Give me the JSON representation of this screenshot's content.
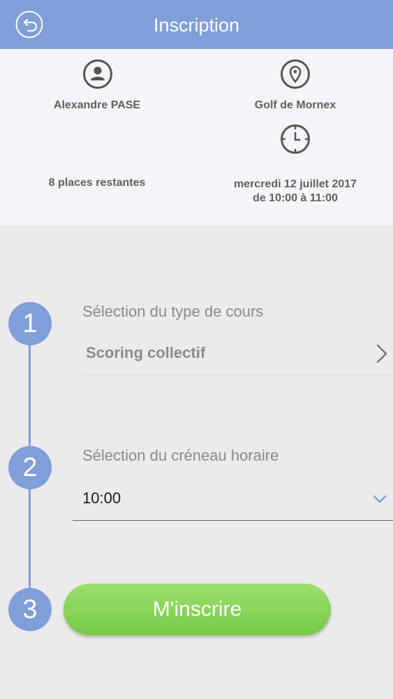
{
  "header": {
    "title": "Inscription",
    "back_icon": "back-arrow-icon",
    "color": "#809fd9"
  },
  "info": {
    "instructor": {
      "icon": "user-icon",
      "name": "Alexandre PASE"
    },
    "location": {
      "icon": "location-pin-icon",
      "name": "Golf de Mornex"
    },
    "time": {
      "icon": "clock-icon"
    },
    "places": "8 places restantes",
    "date_line1": "mercredi 12 juillet 2017",
    "date_line2": "de 10:00 à 11:00"
  },
  "steps": [
    {
      "number": "1",
      "label": "Sélection du type de cours",
      "value": "Scoring collectif",
      "icon": "chevron-right-icon"
    },
    {
      "number": "2",
      "label": "Sélection du créneau horaire",
      "value": "10:00",
      "icon": "chevron-down-icon"
    },
    {
      "number": "3",
      "button_label": "M'inscrire"
    }
  ],
  "colors": {
    "accent": "#809fd9",
    "button_green": "#86d257",
    "background": "#ebebeb",
    "info_background": "#f4f5f9"
  }
}
